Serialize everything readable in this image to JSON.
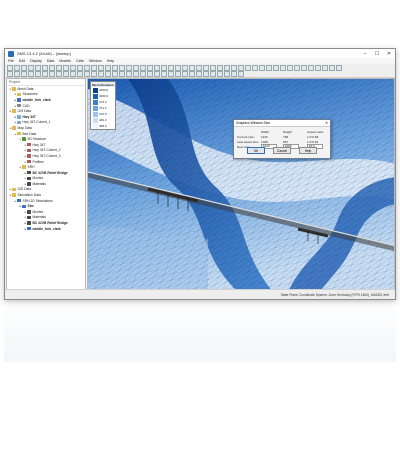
{
  "window": {
    "title": "SMS 13.4.2 (64-bit) – [startup]",
    "controls": {
      "minimize": "–",
      "maximize": "☐",
      "close": "✕"
    }
  },
  "menu": [
    "File",
    "Edit",
    "Display",
    "Data",
    "Models",
    "Cells",
    "Window",
    "Help"
  ],
  "tree": {
    "header": "Project",
    "items": [
      {
        "label": "Mesh Data",
        "bold": false,
        "icon": "folder-icon",
        "color": "#e0b84b"
      },
      {
        "label": "Structures",
        "bold": false,
        "icon": "folder-icon",
        "color": "#e0b84b"
      },
      {
        "label": "middle_fork_clark",
        "bold": true,
        "icon": "mesh-icon",
        "color": "#3a6fc4"
      },
      {
        "label": "CAD",
        "bold": false,
        "icon": "cad-icon",
        "color": "#888888"
      },
      {
        "label": "GIS Data",
        "bold": false,
        "icon": "folder-icon",
        "color": "#e0b84b"
      },
      {
        "label": "Hwy 34T",
        "bold": true,
        "icon": "layer-icon",
        "color": "#7aa7d8"
      },
      {
        "label": "Hwy 34T-Culvert_1",
        "bold": false,
        "icon": "layer-icon",
        "color": "#7aa7d8"
      },
      {
        "label": "Map Data",
        "bold": false,
        "icon": "folder-icon",
        "color": "#e0b84b"
      },
      {
        "label": "Bed Data",
        "bold": false,
        "icon": "folder-icon",
        "color": "#e0b84b"
      },
      {
        "label": "3D Structure",
        "bold": false,
        "icon": "structure-icon",
        "color": "#5c8f3a"
      },
      {
        "label": "Hwy 34T",
        "bold": false,
        "icon": "coverage-icon",
        "color": "#aa5a5a"
      },
      {
        "label": "Hwy 34T-Culvert_2",
        "bold": false,
        "icon": "coverage-icon",
        "color": "#aa5a5a"
      },
      {
        "label": "Hwy 34T-Culvert_3",
        "bold": false,
        "icon": "coverage-icon",
        "color": "#aa5a5a"
      },
      {
        "label": "Profiles",
        "bold": false,
        "icon": "coverage-icon",
        "color": "#aa5a5a"
      },
      {
        "label": "SRH",
        "bold": false,
        "icon": "folder-icon",
        "color": "#e0b84b"
      },
      {
        "label": "BC 32VB Relief Bridge",
        "bold": true,
        "icon": "bridge-icon",
        "color": "#4a4a4a"
      },
      {
        "label": "Monitor",
        "bold": false,
        "icon": "monitor-icon",
        "color": "#4a4a4a"
      },
      {
        "label": "Materials",
        "bold": false,
        "icon": "materials-icon",
        "color": "#4a4a4a"
      },
      {
        "label": "GIS Data",
        "bold": false,
        "icon": "folder-icon",
        "color": "#e0b84b"
      },
      {
        "label": "Simulation Data",
        "bold": false,
        "icon": "folder-icon",
        "color": "#e0b84b"
      },
      {
        "label": "SRH-2D Simulations",
        "bold": false,
        "icon": "sim-icon",
        "color": "#3a6fc4"
      },
      {
        "label": "Sim",
        "bold": true,
        "icon": "sim-icon",
        "color": "#3a6fc4"
      },
      {
        "label": "Monitor",
        "bold": false,
        "icon": "monitor-icon",
        "color": "#4a4a4a"
      },
      {
        "label": "Materials",
        "bold": false,
        "icon": "materials-icon",
        "color": "#4a4a4a"
      },
      {
        "label": "BC 32VB Relief Bridge",
        "bold": true,
        "icon": "bridge-icon",
        "color": "#4a4a4a"
      },
      {
        "label": "middle_fork_clark",
        "bold": true,
        "icon": "mesh-icon",
        "color": "#3a6fc4"
      }
    ]
  },
  "legend": {
    "title": "Mesh Elevation",
    "items": [
      {
        "label": "4000.0",
        "color": "#0d3f8f"
      },
      {
        "label": "4000.0",
        "color": "#1b5cb5"
      },
      {
        "label": "473.0",
        "color": "#3a7fd0"
      },
      {
        "label": "471.2",
        "color": "#6aa3e0"
      },
      {
        "label": "470.5",
        "color": "#9cc3ec"
      },
      {
        "label": "469.3",
        "color": "#c7def5"
      },
      {
        "label": "468.0",
        "color": "#eef5fd"
      }
    ]
  },
  "dialog": {
    "title": "Graphics Window Size",
    "headers": [
      "",
      "Width",
      "Height",
      "Aspect ratio"
    ],
    "rows": [
      [
        "Current size:",
        "1133",
        "768",
        "1.0:0.68"
      ],
      [
        "Last saved size:",
        "1046",
        "967",
        "1.0:0.92"
      ],
      [
        "New size:",
        "1920",
        "1080",
        "16:9"
      ]
    ],
    "buttons": {
      "ok": "OK",
      "cancel": "Cancel",
      "help": "Help"
    }
  },
  "status": {
    "left": "",
    "right": "State Plane Coordinate System, Zone Kentucky (FIPS 1600), NAD83, feet"
  },
  "colors": {
    "mesh_dark": "#0d3f8f",
    "mesh_mid": "#3a7fd0",
    "mesh_light": "#c7def5",
    "accent": "#2b6fc2"
  }
}
